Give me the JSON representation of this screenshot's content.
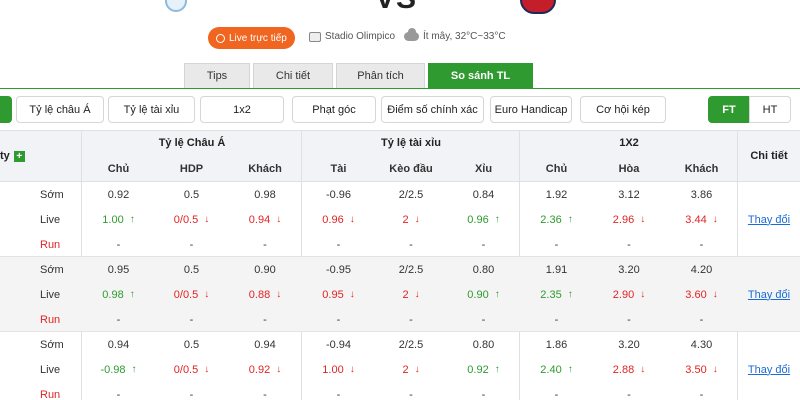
{
  "header": {
    "vs_text": "VS",
    "live_label": "Live trực tiếp",
    "stadium": "Stadio Olimpico",
    "weather": "Ít mây, 32°C~33°C"
  },
  "tabs": [
    {
      "label": "Tips",
      "active": false
    },
    {
      "label": "Chi tiết",
      "active": false
    },
    {
      "label": "Phân tích",
      "active": false
    },
    {
      "label": "So sánh TL",
      "active": true
    }
  ],
  "filters": {
    "asian": "Tỷ lệ châu Á",
    "overunder": "Tỷ lệ tài xỉu",
    "x12": "1x2",
    "corner": "Phạt góc",
    "exact": "Điểm số chính xác",
    "euro_handicap": "Euro Handicap",
    "double_chance": "Cơ hội kép",
    "ft": "FT",
    "ht": "HT"
  },
  "table_header": {
    "company_col": "ty",
    "asian_group": "Tỷ lệ Châu Á",
    "ou_group": "Tỷ lệ tài xỉu",
    "x12_group": "1X2",
    "detail": "Chi tiết",
    "sub": {
      "home": "Chủ",
      "hdp": "HDP",
      "away": "Khách",
      "over": "Tài",
      "line": "Kèo đầu",
      "under": "Xỉu",
      "home2": "Chủ",
      "draw": "Hòa",
      "away2": "Khách"
    }
  },
  "row_labels": {
    "early": "Sớm",
    "live": "Live",
    "run": "Run"
  },
  "change_link": "Thay đổi",
  "blocks": [
    {
      "early": [
        "0.92",
        "0.5",
        "0.98",
        "-0.96",
        "2/2.5",
        "0.84",
        "1.92",
        "3.12",
        "3.86"
      ],
      "live": [
        {
          "v": "1.00",
          "d": "up"
        },
        {
          "v": "0/0.5",
          "d": "down"
        },
        {
          "v": "0.94",
          "d": "down"
        },
        {
          "v": "0.96",
          "d": "down"
        },
        {
          "v": "2",
          "d": "down"
        },
        {
          "v": "0.96",
          "d": "up"
        },
        {
          "v": "2.36",
          "d": "up"
        },
        {
          "v": "2.96",
          "d": "down"
        },
        {
          "v": "3.44",
          "d": "down"
        }
      ],
      "run": [
        "-",
        "-",
        "-",
        "-",
        "-",
        "-",
        "-",
        "-",
        "-"
      ]
    },
    {
      "early": [
        "0.95",
        "0.5",
        "0.90",
        "-0.95",
        "2/2.5",
        "0.80",
        "1.91",
        "3.20",
        "4.20"
      ],
      "live": [
        {
          "v": "0.98",
          "d": "up"
        },
        {
          "v": "0/0.5",
          "d": "down"
        },
        {
          "v": "0.88",
          "d": "down"
        },
        {
          "v": "0.95",
          "d": "down"
        },
        {
          "v": "2",
          "d": "down"
        },
        {
          "v": "0.90",
          "d": "up"
        },
        {
          "v": "2.35",
          "d": "up"
        },
        {
          "v": "2.90",
          "d": "down"
        },
        {
          "v": "3.60",
          "d": "down"
        }
      ],
      "run": [
        "-",
        "-",
        "-",
        "-",
        "-",
        "-",
        "-",
        "-",
        "-"
      ]
    },
    {
      "early": [
        "0.94",
        "0.5",
        "0.94",
        "-0.94",
        "2/2.5",
        "0.80",
        "1.86",
        "3.20",
        "4.30"
      ],
      "live": [
        {
          "v": "-0.98",
          "d": "up"
        },
        {
          "v": "0/0.5",
          "d": "down"
        },
        {
          "v": "0.92",
          "d": "down"
        },
        {
          "v": "1.00",
          "d": "down"
        },
        {
          "v": "2",
          "d": "down"
        },
        {
          "v": "0.92",
          "d": "up"
        },
        {
          "v": "2.40",
          "d": "up"
        },
        {
          "v": "2.88",
          "d": "down"
        },
        {
          "v": "3.50",
          "d": "down"
        }
      ],
      "run": [
        "-",
        "-",
        "-",
        "-",
        "-",
        "-",
        "-",
        "-",
        "-"
      ]
    }
  ],
  "colors": {
    "green": "#2f9a2f",
    "orange": "#f0651f",
    "red": "#e02424",
    "link": "#1a6cd6"
  }
}
